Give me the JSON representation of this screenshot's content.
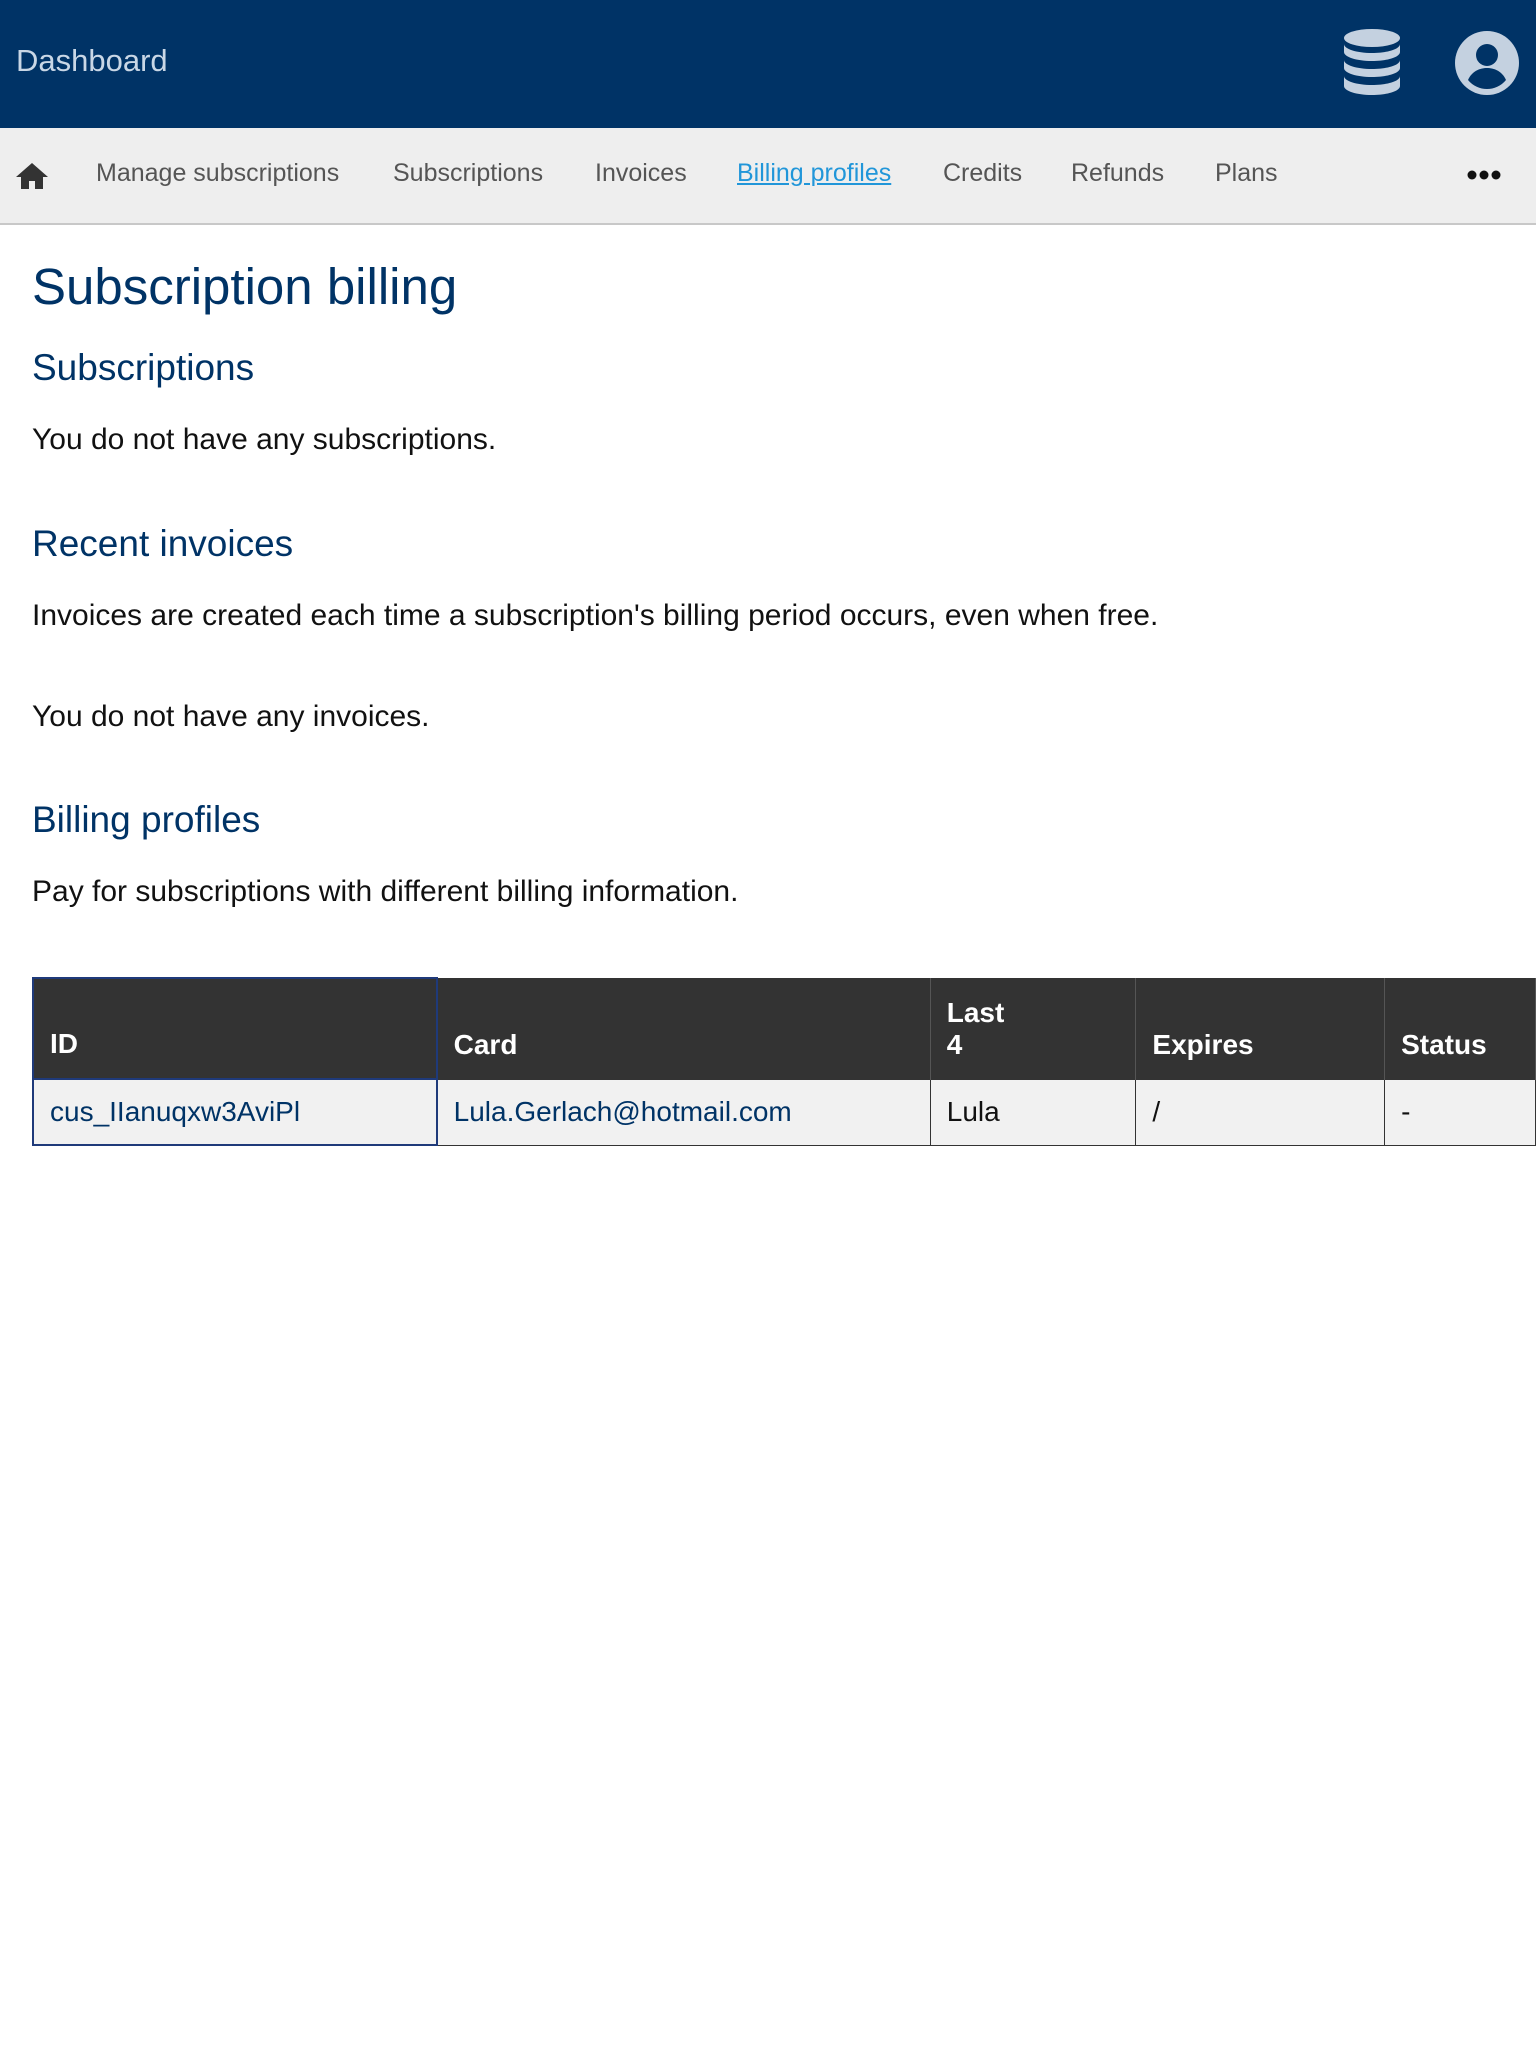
{
  "header": {
    "brand": "Dashboard"
  },
  "nav": {
    "items": [
      {
        "label": "Manage subscriptions"
      },
      {
        "label": "Subscriptions"
      },
      {
        "label": "Invoices"
      },
      {
        "label": "Billing profiles",
        "active": true
      },
      {
        "label": "Credits"
      },
      {
        "label": "Refunds"
      },
      {
        "label": "Plans"
      }
    ]
  },
  "main": {
    "title": "Subscription billing",
    "subscriptions": {
      "heading": "Subscriptions",
      "empty": "You do not have any subscriptions."
    },
    "invoices": {
      "heading": "Recent invoices",
      "description": "Invoices are created each time a subscription's billing period occurs, even when free.",
      "empty": "You do not have any invoices."
    },
    "billing_profiles": {
      "heading": "Billing profiles",
      "description": "Pay for subscriptions with different billing information.",
      "table": {
        "columns": [
          "ID",
          "Card",
          "Last 4",
          "Expires",
          "Status"
        ],
        "rows": [
          {
            "id": "cus_IIanuqxw3AviPl",
            "card": "Lula.Gerlach@hotmail.com",
            "last4": "Lula",
            "expires": "/",
            "status": "-"
          }
        ]
      }
    }
  },
  "colors": {
    "header_bg": "#003366",
    "heading": "#003366",
    "active_link": "#2196d9",
    "table_header_bg": "#333333"
  },
  "icons": [
    "database-icon",
    "user-icon",
    "home-icon",
    "more-icon"
  ]
}
